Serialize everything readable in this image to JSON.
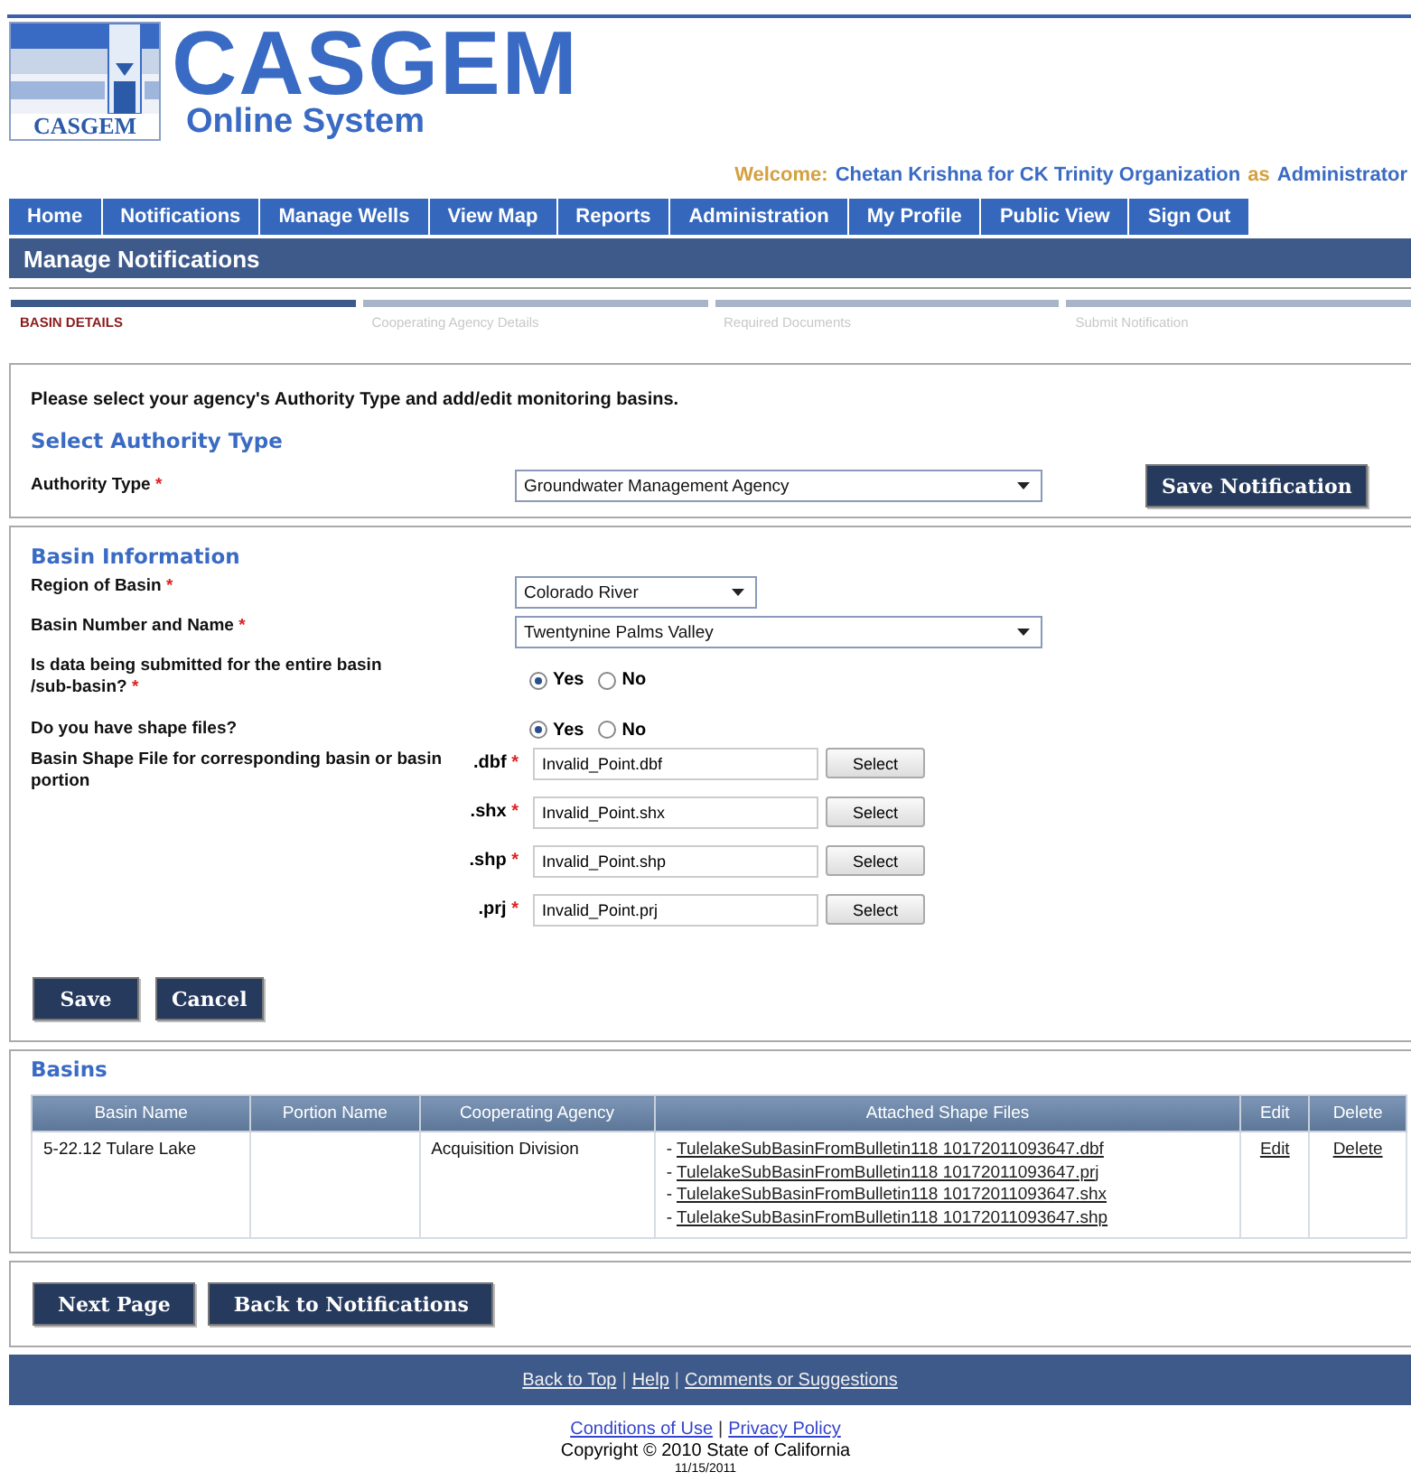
{
  "header": {
    "logo_caption": "CASGEM",
    "title": "CASGEM",
    "subtitle": "Online System"
  },
  "welcome": {
    "label": "Welcome:",
    "user": "Chetan Krishna for CK Trinity Organization",
    "connector": "as",
    "role": "Administrator"
  },
  "nav": [
    {
      "label": "Home"
    },
    {
      "label": "Notifications"
    },
    {
      "label": "Manage Wells"
    },
    {
      "label": "View Map"
    },
    {
      "label": "Reports"
    },
    {
      "label": "Administration"
    },
    {
      "label": "My Profile"
    },
    {
      "label": "Public View"
    },
    {
      "label": "Sign Out"
    }
  ],
  "page_title": "Manage Notifications",
  "steps": [
    {
      "label": "BASIN DETAILS",
      "selected": true
    },
    {
      "label": "Cooperating Agency Details",
      "selected": false
    },
    {
      "label": "Required Documents",
      "selected": false
    },
    {
      "label": "Submit Notification",
      "selected": false
    }
  ],
  "intro": "Please select your agency's Authority Type and add/edit monitoring basins.",
  "authority": {
    "heading": "Select Authority Type",
    "label": "Authority Type",
    "required_mark": "*",
    "value": "Groundwater Management Agency",
    "save_button": "Save Notification"
  },
  "basin_info": {
    "heading": "Basin Information",
    "region": {
      "label": "Region of Basin",
      "required_mark": "*",
      "value": "Colorado River"
    },
    "basin": {
      "label": "Basin Number and Name",
      "required_mark": "*",
      "value": "Twentynine Palms Valley"
    },
    "questions": [
      {
        "label": "Is data being submitted for the entire basin /sub-basin?",
        "required_mark": "*",
        "options": [
          {
            "label": "Yes",
            "selected": true
          },
          {
            "label": "No",
            "selected": false
          }
        ]
      },
      {
        "label": "Do you have shape files?",
        "options": [
          {
            "label": "Yes",
            "selected": true
          },
          {
            "label": "No",
            "selected": false
          }
        ]
      }
    ],
    "files_label": "Basin Shape File for corresponding basin or basin portion",
    "files": [
      {
        "ext": ".dbf",
        "required_mark": "*",
        "value": "Invalid_Point.dbf",
        "button": "Select"
      },
      {
        "ext": ".shx",
        "required_mark": "*",
        "value": "Invalid_Point.shx",
        "button": "Select"
      },
      {
        "ext": ".shp",
        "required_mark": "*",
        "value": "Invalid_Point.shp",
        "button": "Select"
      },
      {
        "ext": ".prj",
        "required_mark": "*",
        "value": "Invalid_Point.prj",
        "button": "Select"
      }
    ],
    "buttons": [
      "Save",
      "Cancel"
    ]
  },
  "basins": {
    "heading": "Basins",
    "columns": [
      "Basin Name",
      "Portion Name",
      "Cooperating Agency",
      "Attached Shape Files",
      "Edit",
      "Delete"
    ],
    "rows": [
      {
        "basin_name": "5-22.12 Tulare Lake",
        "agency": "Acquisition Division",
        "files": [
          {
            "bullet": "-",
            "name": "TulelakeSubBasinFromBulletin118 10172011093647.dbf"
          },
          {
            "bullet": "-",
            "name": "TulelakeSubBasinFromBulletin118 10172011093647.prj"
          },
          {
            "bullet": "-",
            "name": "TulelakeSubBasinFromBulletin118 10172011093647.shx"
          },
          {
            "bullet": "-",
            "name": "TulelakeSubBasinFromBulletin118 10172011093647.shp"
          }
        ],
        "edit": "Edit",
        "delete": "Delete"
      }
    ]
  },
  "page_buttons": [
    "Next Page",
    "Back to Notifications"
  ],
  "footer": {
    "links": [
      "Back to Top",
      "Help",
      "Comments or Suggestions"
    ],
    "separators": [
      "|",
      "|"
    ],
    "legal_links": [
      "Conditions of Use",
      "Privacy Policy"
    ],
    "legal_separators": [
      "|"
    ],
    "copyright": "Copyright © 2010 State of California",
    "date": "11/15/2011"
  }
}
